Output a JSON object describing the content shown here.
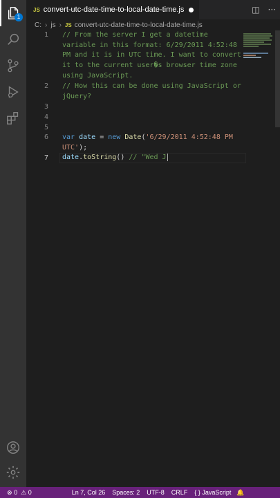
{
  "tab": {
    "js_label": "JS",
    "filename": "convert-utc-date-time-to-local-date-time.js"
  },
  "activity": {
    "explorer_badge": "1"
  },
  "breadcrumb": {
    "drive": "C:",
    "folder": "js",
    "js_label": "JS",
    "file": "convert-utc-date-time-to-local-date-time.js"
  },
  "editor": {
    "line_numbers": [
      "1",
      "2",
      "3",
      "4",
      "5",
      "6",
      "7"
    ],
    "line1": "// From the server I get a datetime variable in this format: 6/29/2011 4:52:48 PM and it is in UTC time. I want to convert it to the current user�s browser time zone using JavaScript.",
    "line2": "// How this can be done using JavaScript or jQuery?",
    "line6": {
      "kw_var": "var",
      "ident": "date",
      "op": " = ",
      "kw_new": "new",
      "fn": "Date",
      "open": "(",
      "str": "'6/29/2011 4:52:48 PM UTC'",
      "close": ");"
    },
    "line7": {
      "ident": "date",
      "dot": ".",
      "fn": "toString",
      "call": "()",
      "comment": " // \"Wed J"
    }
  },
  "status": {
    "problems": "0",
    "warnings": "0",
    "position": "Ln 7, Col 26",
    "spaces": "Spaces: 2",
    "encoding": "UTF-8",
    "eol": "CRLF",
    "language": "JavaScript"
  },
  "colors": {
    "status_bar": "#68217a",
    "editor_bg": "#1e1e1e",
    "comment": "#6a9955",
    "keyword": "#569cd6"
  }
}
